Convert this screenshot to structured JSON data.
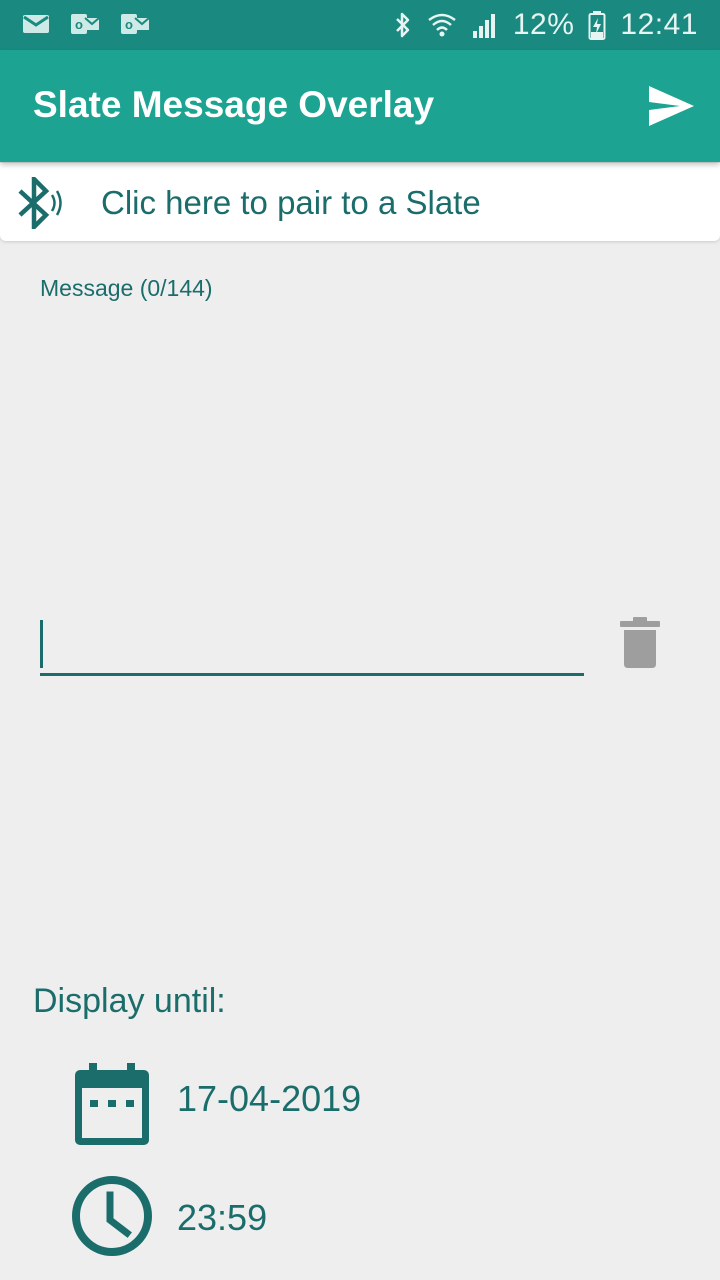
{
  "status_bar": {
    "battery": "12%",
    "time": "12:41",
    "notification_icons": [
      "email-icon",
      "outlook-icon",
      "outlook-icon"
    ],
    "system_icons": [
      "bluetooth-icon",
      "wifi-icon",
      "signal-icon",
      "battery-charging-icon"
    ]
  },
  "app_bar": {
    "title": "Slate Message Overlay",
    "action_icon": "send-icon"
  },
  "pair": {
    "label": "Clic here to pair to a Slate",
    "icon": "bluetooth-audio-icon"
  },
  "message": {
    "label": "Message (0/144)",
    "value": ""
  },
  "display_until": {
    "label": "Display until:",
    "date": "17-04-2019",
    "time": "23:59"
  },
  "colors": {
    "status_bar": "#1a8a80",
    "app_bar": "#1da391",
    "text_accent": "#1b6d6b",
    "background": "#eeeeee",
    "trash": "#9e9e9e"
  }
}
